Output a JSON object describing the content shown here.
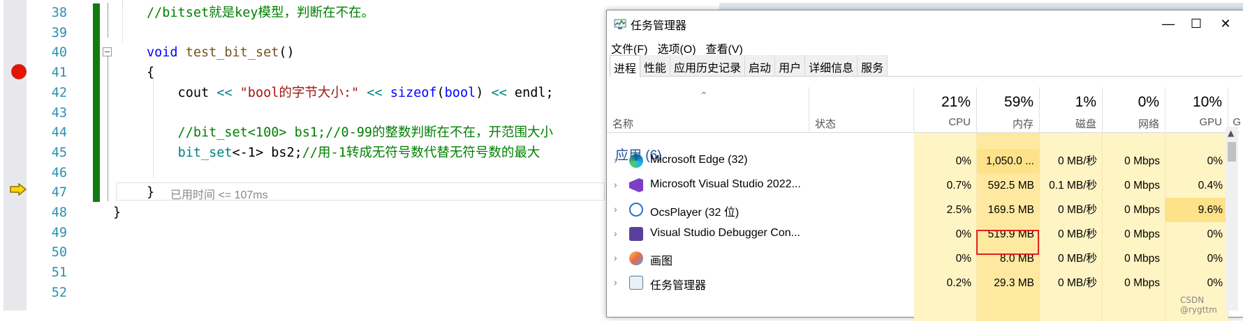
{
  "editor": {
    "line_numbers": [
      "38",
      "39",
      "40",
      "41",
      "42",
      "43",
      "44",
      "45",
      "46",
      "47",
      "48",
      "49",
      "50",
      "51",
      "52"
    ],
    "code_lines": [
      {
        "parts": [
          {
            "t": "//bitset就是key模型，判断在不在。",
            "c": "cm"
          }
        ]
      },
      {
        "parts": []
      },
      {
        "parts": [
          {
            "t": "void",
            "c": "kw"
          },
          {
            "t": " ",
            "c": ""
          },
          {
            "t": "test_bit_set",
            "c": "fn"
          },
          {
            "t": "()",
            "c": ""
          }
        ]
      },
      {
        "parts": [
          {
            "t": "{",
            "c": ""
          }
        ]
      },
      {
        "parts": [
          {
            "t": "    cout ",
            "c": ""
          },
          {
            "t": "<<",
            "c": "op"
          },
          {
            "t": " ",
            "c": ""
          },
          {
            "t": "\"bool的字节大小:\"",
            "c": "str"
          },
          {
            "t": " ",
            "c": ""
          },
          {
            "t": "<<",
            "c": "op"
          },
          {
            "t": " ",
            "c": ""
          },
          {
            "t": "sizeof",
            "c": "kw"
          },
          {
            "t": "(",
            "c": ""
          },
          {
            "t": "bool",
            "c": "kw"
          },
          {
            "t": ") ",
            "c": ""
          },
          {
            "t": "<<",
            "c": "op"
          },
          {
            "t": " endl;",
            "c": ""
          }
        ]
      },
      {
        "parts": []
      },
      {
        "parts": [
          {
            "t": "    //bit_set<100> bs1;//0-99的整数判断在不在，开范围大小",
            "c": "cm"
          }
        ]
      },
      {
        "parts": [
          {
            "t": "    ",
            "c": ""
          },
          {
            "t": "bit_set",
            "c": "op"
          },
          {
            "t": "<-1> bs2;",
            "c": ""
          },
          {
            "t": "//用-1转成无符号数代替无符号数的最大",
            "c": "cm"
          }
        ]
      },
      {
        "parts": []
      },
      {
        "parts": [
          {
            "t": "}",
            "c": ""
          }
        ]
      },
      {
        "parts": [
          {
            "t": "}",
            "c": ""
          }
        ]
      },
      {
        "parts": []
      },
      {
        "parts": []
      },
      {
        "parts": []
      },
      {
        "parts": []
      }
    ],
    "perf_tip": "已用时间 <= 107ms"
  },
  "task_manager": {
    "title": "任务管理器",
    "controls": {
      "minimize": "—",
      "maximize": "☐",
      "close": "✕"
    },
    "menu": [
      "文件(F)",
      "选项(O)",
      "查看(V)"
    ],
    "tabs": [
      "进程",
      "性能",
      "应用历史记录",
      "启动",
      "用户",
      "详细信息",
      "服务"
    ],
    "active_tab": "进程",
    "headers": {
      "name": "名称",
      "status": "状态",
      "columns": [
        {
          "pct": "21%",
          "label": "CPU"
        },
        {
          "pct": "59%",
          "label": "内存"
        },
        {
          "pct": "1%",
          "label": "磁盘"
        },
        {
          "pct": "0%",
          "label": "网络"
        },
        {
          "pct": "10%",
          "label": "GPU"
        },
        {
          "pct": "",
          "label": "G"
        }
      ]
    },
    "group_label": "应用 (6)",
    "rows": [
      {
        "name": "Microsoft Edge (32)",
        "icon": "edge-icon",
        "cpu": "0%",
        "mem": "1,050.0 ...",
        "disk": "0 MB/秒",
        "net": "0 Mbps",
        "gpu": "0%"
      },
      {
        "name": "Microsoft Visual Studio 2022...",
        "icon": "visual-studio-icon",
        "cpu": "0.7%",
        "mem": "592.5 MB",
        "disk": "0.1 MB/秒",
        "net": "0 Mbps",
        "gpu": "0.4%"
      },
      {
        "name": "OcsPlayer (32 位)",
        "icon": "ocsplayer-icon",
        "cpu": "2.5%",
        "mem": "169.5 MB",
        "disk": "0 MB/秒",
        "net": "0 Mbps",
        "gpu": "9.6%"
      },
      {
        "name": "Visual Studio Debugger Con...",
        "icon": "console-icon",
        "cpu": "0%",
        "mem": "519.9 MB",
        "disk": "0 MB/秒",
        "net": "0 Mbps",
        "gpu": "0%"
      },
      {
        "name": "画图",
        "icon": "paint-icon",
        "cpu": "0%",
        "mem": "8.0 MB",
        "disk": "0 MB/秒",
        "net": "0 Mbps",
        "gpu": "0%"
      },
      {
        "name": "任务管理器",
        "icon": "task-manager-icon",
        "cpu": "0.2%",
        "mem": "29.3 MB",
        "disk": "0 MB/秒",
        "net": "0 Mbps",
        "gpu": "0%"
      }
    ],
    "heat_colors": {
      "light": "#fff4c4",
      "mid": "#ffe9a0",
      "strong": "#fde28a"
    }
  },
  "watermark": "CSDN @rygttm"
}
